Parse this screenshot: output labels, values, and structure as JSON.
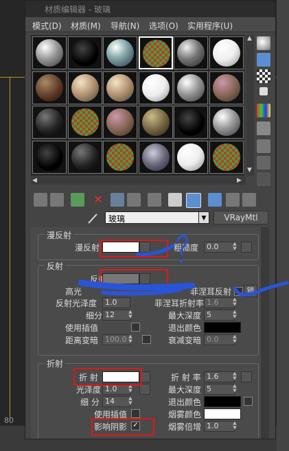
{
  "window": {
    "title": "材质编辑器 - 玻璃"
  },
  "menu": [
    "模式(D)",
    "材质(M)",
    "导航(N)",
    "选项(O)",
    "实用程序(U)"
  ],
  "slots": [
    {
      "icon": "gray-sphere-slot"
    },
    {
      "icon": "black-sphere-slot"
    },
    {
      "icon": "glass-sphere-slot"
    },
    {
      "icon": "checker-sphere-slot"
    },
    {
      "icon": "metal-sphere-slot"
    },
    {
      "icon": "white-sphere-slot"
    },
    {
      "icon": "wood-sphere-slot"
    },
    {
      "icon": "beige-sphere-slot"
    },
    {
      "icon": "beige-sphere-slot"
    },
    {
      "icon": "white-sphere-slot"
    },
    {
      "icon": "gray-sphere-slot"
    },
    {
      "icon": "stone-sphere-slot"
    },
    {
      "icon": "dark-sphere-slot"
    },
    {
      "icon": "checker-sphere-slot"
    },
    {
      "icon": "stone-sphere-slot"
    },
    {
      "icon": "brass-sphere-slot"
    },
    {
      "icon": "black-sphere-slot"
    },
    {
      "icon": "gray-sphere-slot"
    },
    {
      "icon": "black-sphere-slot"
    },
    {
      "icon": "dark-sphere-slot"
    },
    {
      "icon": "checker-sphere-slot"
    },
    {
      "icon": "building-sphere-slot"
    },
    {
      "icon": "white-sphere-slot"
    },
    {
      "icon": "checker-sphere-slot"
    }
  ],
  "material": {
    "name": "玻璃",
    "type": "VRayMtl"
  },
  "diffuse": {
    "title": "漫反射",
    "diffuse_label": "漫反射",
    "roughness_label": "粗糙度",
    "roughness_value": "0.0"
  },
  "reflection": {
    "title": "反射",
    "reflect_label": "反射",
    "hilight_label": "高光",
    "lock_label": "锁",
    "fresnel_label": "菲涅耳反射",
    "gloss_label": "反射光泽度",
    "gloss_value": "1.0",
    "fresnel_ior_label": "菲涅耳折射率",
    "fresnel_ior_value": "1.6",
    "subdivs_label": "细分",
    "subdivs_value": "12",
    "max_depth_label": "最大深度",
    "max_depth_value": "5",
    "interp_label": "使用插值",
    "exit_color_label": "退出颜色",
    "dim_dist_label": "距离变暗",
    "dim_dist_value": "100.0",
    "dim_falloff_label": "衰减变暗",
    "dim_falloff_value": "0.0"
  },
  "refraction": {
    "title": "折射",
    "refract_label": "折 射",
    "ior_label": "折 射 率",
    "ior_value": "1.6",
    "gloss_label": "光泽度",
    "gloss_value": "1.0",
    "max_depth_label": "最大深度",
    "max_depth_value": "5",
    "subdivs_label": "细 分",
    "subdivs_value": "14",
    "exit_color_label": "退出颜色",
    "interp_label": "使用插值",
    "fog_color_label": "烟雾颜色",
    "affect_shadows_label": "影响阴影",
    "fog_mult_label": "烟雾倍增",
    "fog_mult_value": "1.0"
  },
  "viewport": {
    "frame_number": "80"
  },
  "colors": {
    "annotation_red": "#e01818",
    "annotation_blue": "#2a54d8",
    "viewport_border": "#b8922e"
  }
}
